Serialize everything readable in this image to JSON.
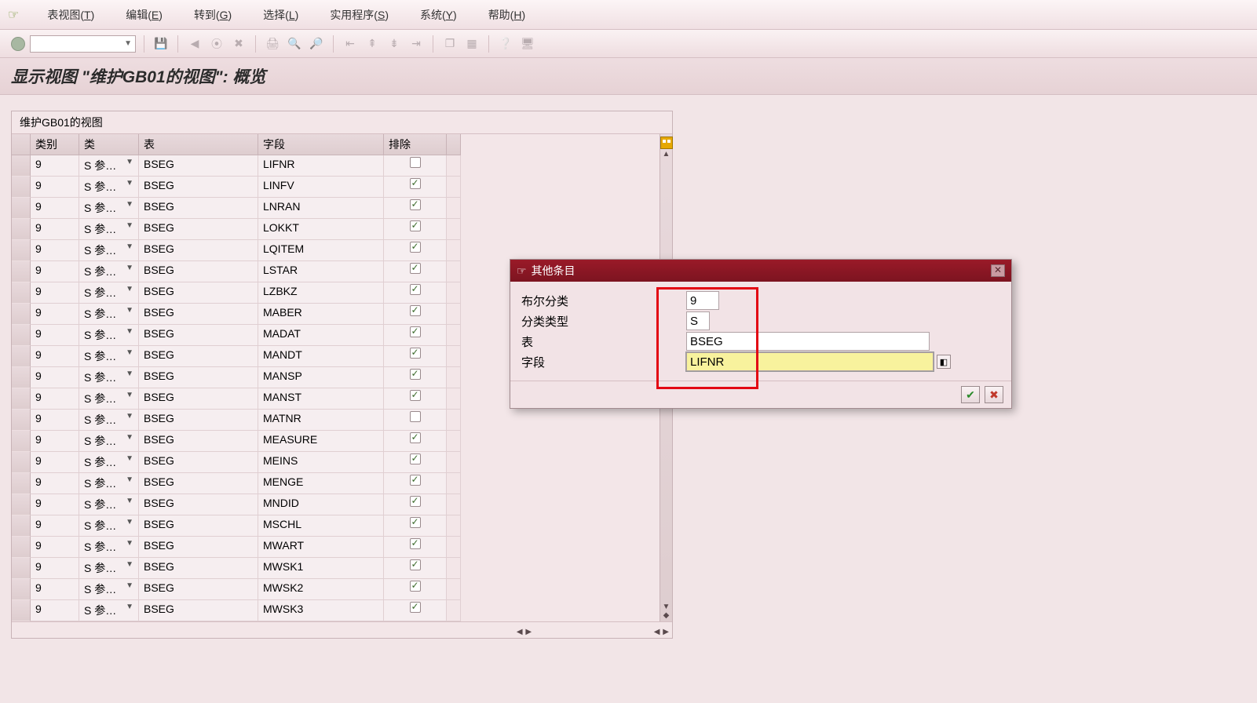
{
  "menu": {
    "items": [
      {
        "label": "表视图",
        "accel": "T"
      },
      {
        "label": "编辑",
        "accel": "E"
      },
      {
        "label": "转到",
        "accel": "G"
      },
      {
        "label": "选择",
        "accel": "L"
      },
      {
        "label": "实用程序",
        "accel": "S"
      },
      {
        "label": "系统",
        "accel": "Y"
      },
      {
        "label": "帮助",
        "accel": "H"
      }
    ]
  },
  "page_title": "显示视图 \"维护GB01的视图\": 概览",
  "table": {
    "caption": "维护GB01的视图",
    "columns": [
      "类别",
      "类",
      "表",
      "字段",
      "排除"
    ],
    "rows": [
      {
        "cat": "9",
        "cls": "S",
        "cls2": "参…",
        "tab": "BSEG",
        "fld": "LIFNR",
        "ex": false
      },
      {
        "cat": "9",
        "cls": "S",
        "cls2": "参…",
        "tab": "BSEG",
        "fld": "LINFV",
        "ex": true
      },
      {
        "cat": "9",
        "cls": "S",
        "cls2": "参…",
        "tab": "BSEG",
        "fld": "LNRAN",
        "ex": true
      },
      {
        "cat": "9",
        "cls": "S",
        "cls2": "参…",
        "tab": "BSEG",
        "fld": "LOKKT",
        "ex": true
      },
      {
        "cat": "9",
        "cls": "S",
        "cls2": "参…",
        "tab": "BSEG",
        "fld": "LQITEM",
        "ex": true
      },
      {
        "cat": "9",
        "cls": "S",
        "cls2": "参…",
        "tab": "BSEG",
        "fld": "LSTAR",
        "ex": true
      },
      {
        "cat": "9",
        "cls": "S",
        "cls2": "参…",
        "tab": "BSEG",
        "fld": "LZBKZ",
        "ex": true
      },
      {
        "cat": "9",
        "cls": "S",
        "cls2": "参…",
        "tab": "BSEG",
        "fld": "MABER",
        "ex": true
      },
      {
        "cat": "9",
        "cls": "S",
        "cls2": "参…",
        "tab": "BSEG",
        "fld": "MADAT",
        "ex": true
      },
      {
        "cat": "9",
        "cls": "S",
        "cls2": "参…",
        "tab": "BSEG",
        "fld": "MANDT",
        "ex": true
      },
      {
        "cat": "9",
        "cls": "S",
        "cls2": "参…",
        "tab": "BSEG",
        "fld": "MANSP",
        "ex": true
      },
      {
        "cat": "9",
        "cls": "S",
        "cls2": "参…",
        "tab": "BSEG",
        "fld": "MANST",
        "ex": true
      },
      {
        "cat": "9",
        "cls": "S",
        "cls2": "参…",
        "tab": "BSEG",
        "fld": "MATNR",
        "ex": false
      },
      {
        "cat": "9",
        "cls": "S",
        "cls2": "参…",
        "tab": "BSEG",
        "fld": "MEASURE",
        "ex": true
      },
      {
        "cat": "9",
        "cls": "S",
        "cls2": "参…",
        "tab": "BSEG",
        "fld": "MEINS",
        "ex": true
      },
      {
        "cat": "9",
        "cls": "S",
        "cls2": "参…",
        "tab": "BSEG",
        "fld": "MENGE",
        "ex": true
      },
      {
        "cat": "9",
        "cls": "S",
        "cls2": "参…",
        "tab": "BSEG",
        "fld": "MNDID",
        "ex": true
      },
      {
        "cat": "9",
        "cls": "S",
        "cls2": "参…",
        "tab": "BSEG",
        "fld": "MSCHL",
        "ex": true
      },
      {
        "cat": "9",
        "cls": "S",
        "cls2": "参…",
        "tab": "BSEG",
        "fld": "MWART",
        "ex": true
      },
      {
        "cat": "9",
        "cls": "S",
        "cls2": "参…",
        "tab": "BSEG",
        "fld": "MWSK1",
        "ex": true
      },
      {
        "cat": "9",
        "cls": "S",
        "cls2": "参…",
        "tab": "BSEG",
        "fld": "MWSK2",
        "ex": true
      },
      {
        "cat": "9",
        "cls": "S",
        "cls2": "参…",
        "tab": "BSEG",
        "fld": "MWSK3",
        "ex": true
      }
    ]
  },
  "dialog": {
    "title": "其他条目",
    "fields": {
      "bool_class_label": "布尔分类",
      "bool_class_value": "9",
      "type_label": "分类类型",
      "type_value": "S",
      "table_label": "表",
      "table_value": "BSEG",
      "field_label": "字段",
      "field_value": "LIFNR"
    }
  }
}
